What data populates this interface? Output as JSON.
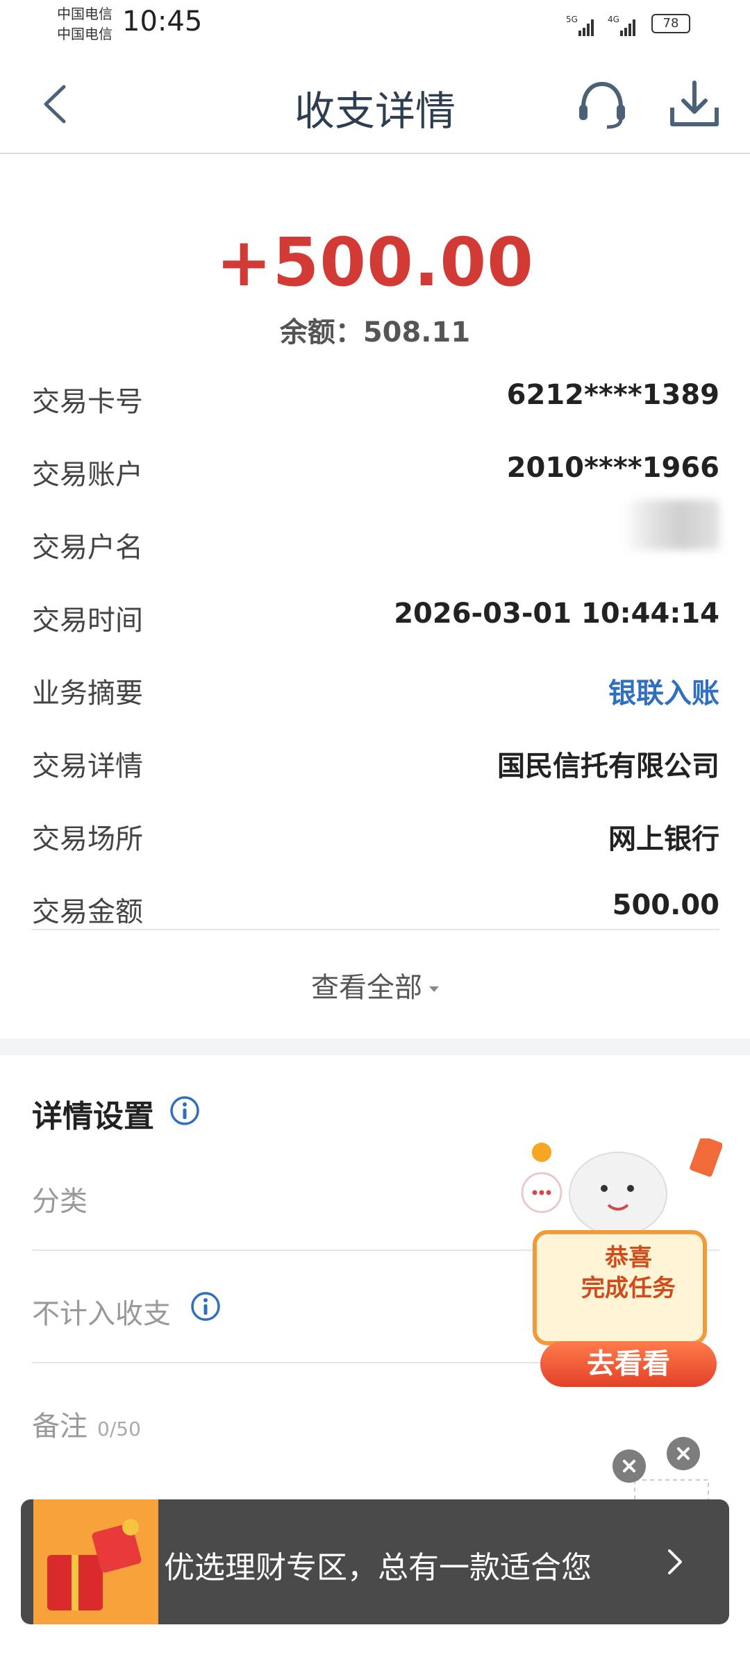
{
  "status_bar": {
    "carrier_1": "中国电信",
    "carrier_2": "中国电信",
    "time": "10:45",
    "battery": "78"
  },
  "header": {
    "title": "收支详情",
    "back_icon": "chevron-left-icon",
    "service_icon": "headset-icon",
    "download_icon": "download-icon"
  },
  "summary": {
    "amount": "+500.00",
    "balance_label": "余额：",
    "balance_value": "508.11"
  },
  "details": [
    {
      "label": "交易卡号",
      "value": "6212****1389"
    },
    {
      "label": "交易账户",
      "value": "2010****1966"
    },
    {
      "label": "交易户名",
      "value": ""
    },
    {
      "label": "交易时间",
      "value": "2026-03-01 10:44:14"
    },
    {
      "label": "业务摘要",
      "value": "银联入账"
    },
    {
      "label": "交易详情",
      "value": "国民信托有限公司"
    },
    {
      "label": "交易场所",
      "value": "网上银行"
    },
    {
      "label": "交易金额",
      "value": "500.00"
    }
  ],
  "view_all": "查看全部",
  "settings": {
    "title": "详情设置",
    "category_label": "分类",
    "exclude_label": "不计入收支",
    "note_label": "备注",
    "note_counter": "0/50"
  },
  "promo": {
    "line1": "恭喜",
    "line2": "完成任务",
    "button": "去看看"
  },
  "banner": {
    "text": "优选理财专区，总有一款适合您"
  },
  "colors": {
    "amount": "#d23b35",
    "link": "#2f6fbd",
    "info_icon": "#2f6fbd"
  }
}
